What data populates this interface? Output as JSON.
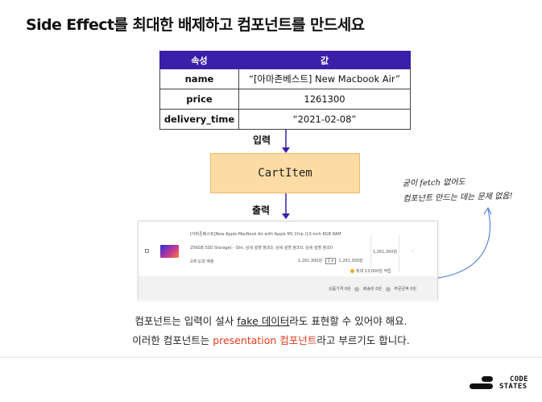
{
  "title": "Side Effect를 최대한 배제하고 컴포넌트를 만드세요",
  "props_table": {
    "headers": [
      "속성",
      "값"
    ],
    "rows": [
      {
        "key": "name",
        "value": "“[아마존베스트] New Macbook Air”"
      },
      {
        "key": "price",
        "value": "1261300"
      },
      {
        "key": "delivery_time",
        "value": "“2021-02-08”"
      }
    ]
  },
  "input_label": "입력",
  "component_name": "CartItem",
  "output_label": "출력",
  "handwritten_note": [
    "굳이 fetch 없어도",
    "컴포넌트 만드는 데는 문제 없음!"
  ],
  "cart_item_preview": {
    "name_line1": "[아마존베스트]New Apple MacBook Air with Apple M1 Chip (13-inch 8GB RAM",
    "name_line2": "256GB SSD Storage) - Silv, 상세 설명 참조0, 상세 설명 참조0, 상세 설명 참조0",
    "shipping": "2/8 도착 예정",
    "unit_price": "1,261,300원",
    "quantity": "1",
    "line_total": "1,261,300원",
    "point_note": "최대 13,000원 적립",
    "price_cell": "1,261,300원",
    "delivery_cell": "-",
    "summary_product": "상품가격 0원",
    "summary_shipping": "배송비 0원",
    "summary_total": "주문금액 0원"
  },
  "caption_line1": {
    "before": "컴포넌트는 입력이 설사 ",
    "underline": "fake 데이터",
    "after": "라도 표현할 수 있어야 해요."
  },
  "caption_line2": {
    "before": "이러한 컴포넌트는 ",
    "highlight": "presentation 컴포넌트",
    "after": "라고 부르기도 합니다."
  },
  "logo": {
    "line1": "CODE",
    "line2": "STATES"
  },
  "colors": {
    "accent": "#3a1fa8",
    "component_fill": "#fcdca4",
    "component_border": "#f0b867",
    "highlight": "#e23b1c"
  }
}
